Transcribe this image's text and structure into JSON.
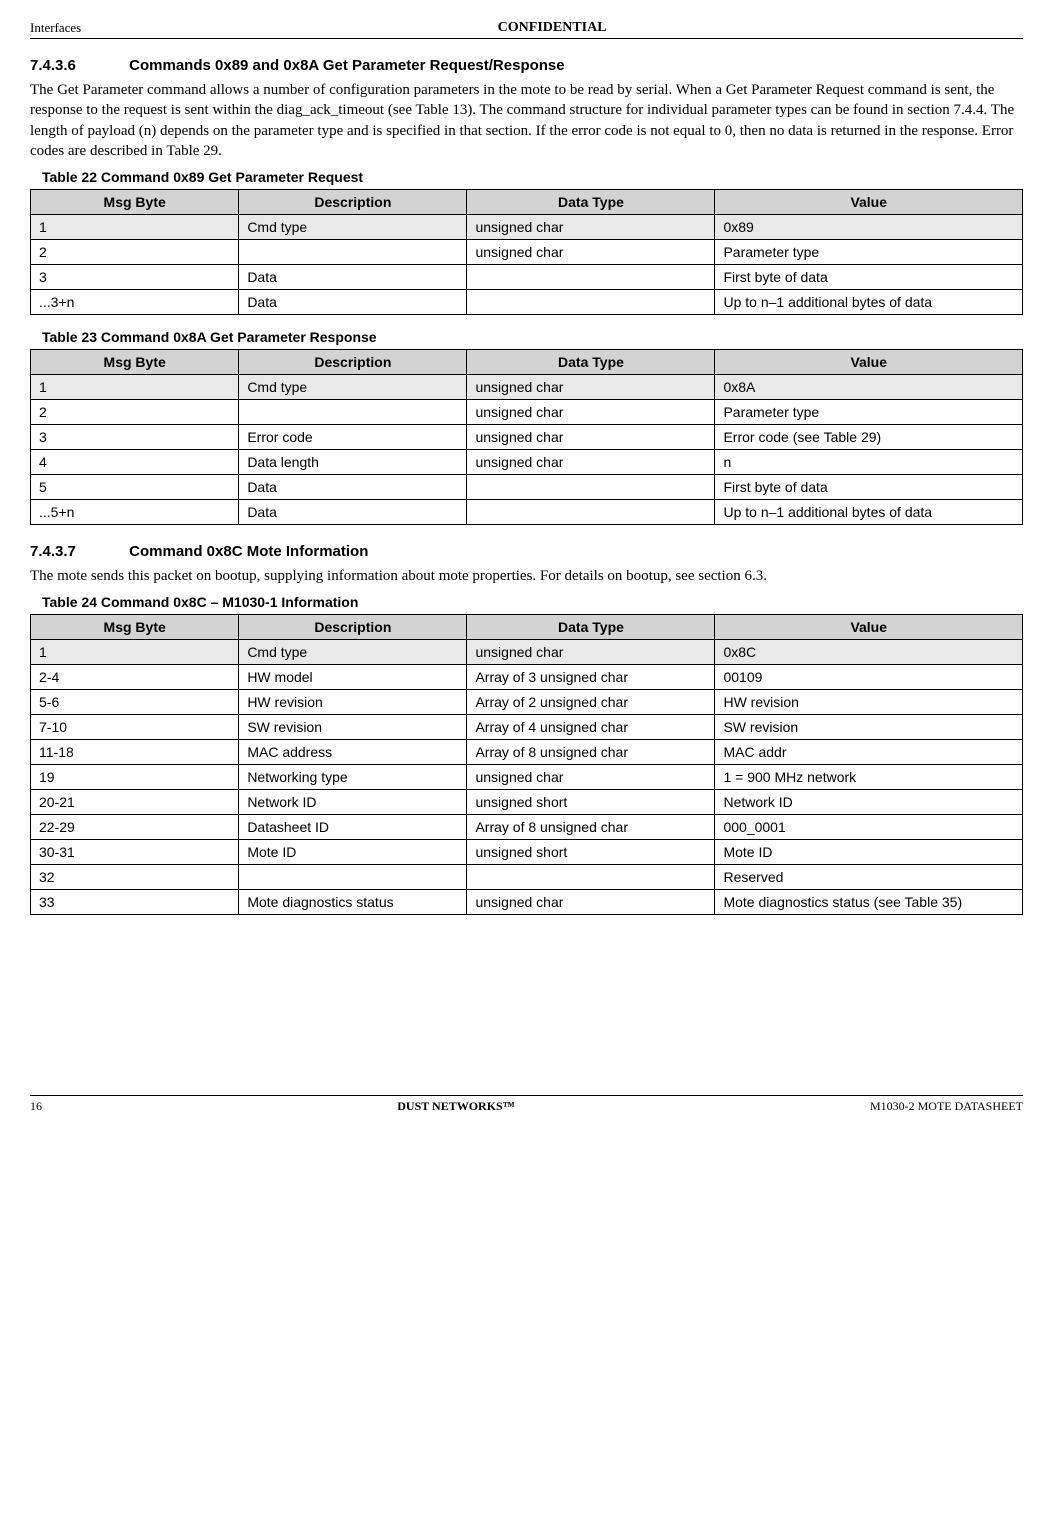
{
  "header": {
    "left": "Interfaces",
    "center": "CONFIDENTIAL"
  },
  "sec1": {
    "num": "7.4.3.6",
    "title": "Commands 0x89 and 0x8A Get Parameter Request/Response",
    "body": "The Get Parameter command allows a number of configuration parameters in the mote to be read by serial. When a Get Parameter Request command is sent, the response to the request is sent within the diag_ack_timeout (see Table 13). The command structure for individual parameter types can be found in section 7.4.4. The length of payload (n) depends on the parameter type and is specified in that section. If the error code is not equal to 0, then no data is returned in the response. Error codes are described in Table 29."
  },
  "table22": {
    "caption": "Table 22    Command 0x89 Get Parameter Request",
    "headers": [
      "Msg Byte",
      "Description",
      "Data Type",
      "Value"
    ],
    "rows": [
      {
        "c": [
          "1",
          "Cmd type",
          "unsigned char",
          "0x89"
        ],
        "shaded": true
      },
      {
        "c": [
          "2",
          "",
          "unsigned char",
          "Parameter type"
        ]
      },
      {
        "c": [
          "3",
          "Data",
          "",
          "First byte of data"
        ]
      },
      {
        "c": [
          " ...3+n",
          "Data",
          "",
          "Up to n–1 additional bytes of data"
        ]
      }
    ]
  },
  "table23": {
    "caption": "Table 23    Command 0x8A Get Parameter Response",
    "headers": [
      "Msg Byte",
      "Description",
      "Data Type",
      "Value"
    ],
    "rows": [
      {
        "c": [
          "1",
          "Cmd type",
          "unsigned char",
          "0x8A"
        ],
        "shaded": true
      },
      {
        "c": [
          "2",
          "",
          "unsigned char",
          "Parameter type"
        ]
      },
      {
        "c": [
          "3",
          "Error code",
          "unsigned char",
          "Error code (see Table 29)"
        ]
      },
      {
        "c": [
          "4",
          "Data length",
          "unsigned char",
          "n"
        ]
      },
      {
        "c": [
          "5",
          "Data",
          "",
          "First byte of data"
        ]
      },
      {
        "c": [
          " ...5+n",
          "Data",
          "",
          "Up to n–1 additional bytes of data"
        ]
      }
    ]
  },
  "sec2": {
    "num": "7.4.3.7",
    "title": "Command 0x8C Mote Information",
    "body": "The mote sends this packet on bootup, supplying information about mote properties. For details on bootup, see section 6.3."
  },
  "table24": {
    "caption": "Table 24    Command 0x8C – M1030-1 Information",
    "headers": [
      "Msg Byte",
      "Description",
      "Data Type",
      "Value"
    ],
    "rows": [
      {
        "c": [
          "1",
          "Cmd type",
          "unsigned char",
          "0x8C"
        ],
        "shaded": true
      },
      {
        "c": [
          "2-4",
          "HW model",
          "Array of 3 unsigned char",
          "00109"
        ]
      },
      {
        "c": [
          "5-6",
          "HW revision",
          "Array of 2 unsigned char",
          "HW revision"
        ]
      },
      {
        "c": [
          "7-10",
          "SW revision",
          "Array of 4 unsigned char",
          "SW revision"
        ]
      },
      {
        "c": [
          "11-18",
          "MAC address",
          "Array of 8 unsigned char",
          "MAC addr"
        ]
      },
      {
        "c": [
          "19",
          "Networking type",
          "unsigned char",
          "1 = 900 MHz network"
        ]
      },
      {
        "c": [
          "20-21",
          "Network ID",
          "unsigned short",
          "Network ID"
        ]
      },
      {
        "c": [
          "22-29",
          "Datasheet ID",
          "Array of 8 unsigned char",
          "000_0001"
        ]
      },
      {
        "c": [
          "30-31",
          "Mote ID",
          "unsigned short",
          "Mote ID"
        ]
      },
      {
        "c": [
          "32",
          "",
          "",
          "Reserved"
        ]
      },
      {
        "c": [
          "33",
          "Mote diagnostics status",
          "unsigned char",
          "Mote diagnostics status (see Table 35)"
        ]
      }
    ]
  },
  "footer": {
    "left": "16",
    "center": "DUST NETWORKS™",
    "right": "M1030-2 MOTE DATASHEET"
  }
}
